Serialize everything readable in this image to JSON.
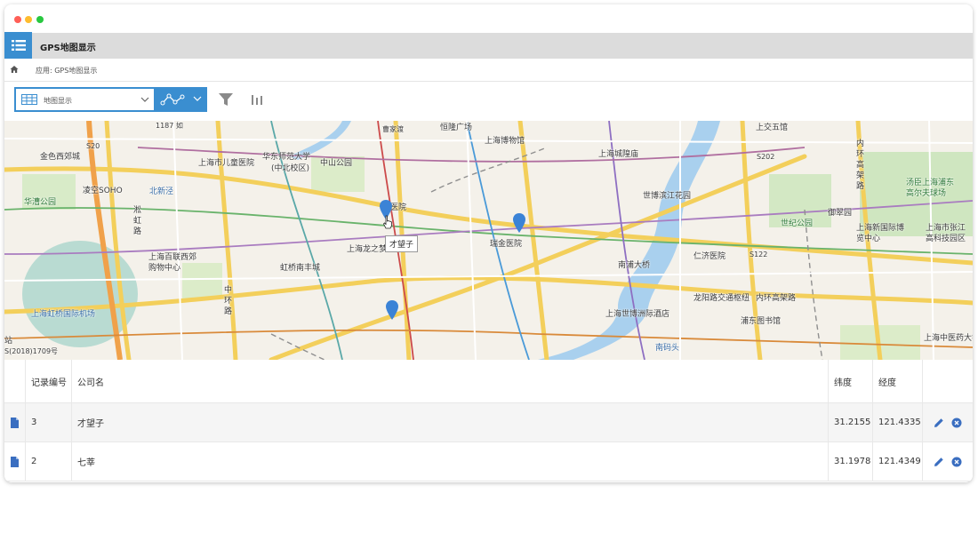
{
  "app": {
    "title": "GPS地图显示"
  },
  "breadcrumb": {
    "text": "应用: GPS地图显示"
  },
  "toolbar": {
    "view_select_label": "地图显示"
  },
  "map": {
    "labels": [
      {
        "text": "1187 如",
        "cls": "small"
      },
      {
        "text": "曹家渡",
        "cls": "small"
      },
      {
        "text": "恒隆广场",
        "cls": ""
      },
      {
        "text": "上海博物馆",
        "cls": ""
      },
      {
        "text": "上交五馆",
        "cls": ""
      },
      {
        "text": "金色西郊城",
        "cls": ""
      },
      {
        "text": "S20",
        "cls": "small"
      },
      {
        "text": "上海市儿童医院",
        "cls": ""
      },
      {
        "text": "华东师范大学",
        "cls": ""
      },
      {
        "text": "(中北校区)",
        "cls": ""
      },
      {
        "text": "中山公园",
        "cls": ""
      },
      {
        "text": "上海城隍庙",
        "cls": ""
      },
      {
        "text": "S202",
        "cls": "small"
      },
      {
        "text": "内环高架路",
        "cls": ""
      },
      {
        "text": "凌空SOHO",
        "cls": ""
      },
      {
        "text": "北新泾",
        "cls": "blue"
      },
      {
        "text": "华漕公园",
        "cls": "green"
      },
      {
        "text": "山医院",
        "cls": ""
      },
      {
        "text": "世博滨江花园",
        "cls": ""
      },
      {
        "text": "御翠园",
        "cls": ""
      },
      {
        "text": "汤臣上海浦东高尔夫球场",
        "cls": "green"
      },
      {
        "text": "淞虹路",
        "cls": ""
      },
      {
        "text": "瑞金医院",
        "cls": ""
      },
      {
        "text": "世纪公园",
        "cls": "green"
      },
      {
        "text": "上海新国际博览中心",
        "cls": ""
      },
      {
        "text": "上海市张江高科技园区",
        "cls": ""
      },
      {
        "text": "上海龙之梦",
        "cls": ""
      },
      {
        "text": "上海百联西郊购物中心",
        "cls": ""
      },
      {
        "text": "虹桥南丰城",
        "cls": ""
      },
      {
        "text": "南浦大桥",
        "cls": ""
      },
      {
        "text": "仁济医院",
        "cls": ""
      },
      {
        "text": "S122",
        "cls": "small"
      },
      {
        "text": "中环路",
        "cls": ""
      },
      {
        "text": "龙阳路交通枢纽",
        "cls": ""
      },
      {
        "text": "内环高架路",
        "cls": ""
      },
      {
        "text": "上海虹桥国际机场",
        "cls": "blue"
      },
      {
        "text": "上海世博洲际酒店",
        "cls": ""
      },
      {
        "text": "浦东图书馆",
        "cls": ""
      },
      {
        "text": "上海中医药大学",
        "cls": ""
      },
      {
        "text": "南码头",
        "cls": "blue"
      },
      {
        "text": "站",
        "cls": ""
      },
      {
        "text": "S(2018)1709号",
        "cls": "small"
      }
    ],
    "marker_tooltip": "才望子"
  },
  "table": {
    "columns": [
      "记录编号",
      "公司名",
      "纬度",
      "经度"
    ],
    "rows": [
      {
        "id": "3",
        "company": "才望子",
        "lat": "31.2155",
        "lng": "121.4335"
      },
      {
        "id": "2",
        "company": "七莘",
        "lat": "31.1978",
        "lng": "121.4349"
      }
    ]
  },
  "colors": {
    "accent": "#3a8ed0",
    "marker": "#3b83d6"
  }
}
